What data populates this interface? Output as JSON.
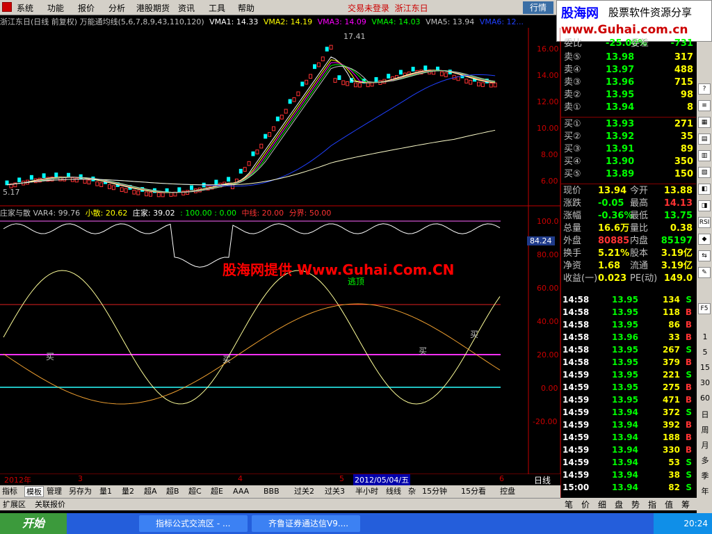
{
  "menu": {
    "items": [
      "系统",
      "功能",
      "报价",
      "分析",
      "港股期货",
      "资讯",
      "工具",
      "帮助"
    ],
    "status": "交易未登录",
    "stock_name": "浙江东日",
    "quote_button": "行情"
  },
  "ad": {
    "brand": "股海网",
    "tagline": "股票软件资源分享",
    "url": "www.Guhai.com.cn"
  },
  "chart_title": {
    "name": "浙江东日(日线 前复权) 万能通均线(5,6,7,8,9,43,110,120)",
    "vma1": "VMA1: 14.33",
    "vma2": "VMA2: 14.19",
    "vma3": "VMA3: 14.09",
    "vma4": "VMA4: 14.03",
    "vma5": "VMA5: 13.94",
    "vma6": "VMA6: 12..."
  },
  "price_axis": [
    "16.00",
    "14.00",
    "12.00",
    "10.00",
    "8.00",
    "6.00"
  ],
  "price_annotations": {
    "high": "17.41",
    "low": "5.17"
  },
  "indicator_title": {
    "name": "庄家与散 VAR4: 99.76",
    "xs": "小散: 20.62",
    "zj": "庄家: 39.02",
    "lines": ": 100.00 : 0.00",
    "mid": "中线: 20.00",
    "div": "分界: 50.00"
  },
  "indicator_axis": [
    "100.0",
    "80.00",
    "60.00",
    "40.00",
    "20.00",
    "0.00",
    "-20.00"
  ],
  "indicator_value_badge": "84.24",
  "indicator_labels": {
    "buy": "买",
    "top": "逃顶"
  },
  "watermark": "股海网提供 Www.Guhai.Com.CN",
  "order_book": {
    "header": {
      "label": "委比",
      "value": "-25.00%",
      "label2": "委差",
      "value2": "-731"
    },
    "asks": [
      {
        "label": "卖⑤",
        "price": "13.98",
        "vol": "317"
      },
      {
        "label": "卖④",
        "price": "13.97",
        "vol": "488"
      },
      {
        "label": "卖③",
        "price": "13.96",
        "vol": "715"
      },
      {
        "label": "卖②",
        "price": "13.95",
        "vol": "98"
      },
      {
        "label": "卖①",
        "price": "13.94",
        "vol": "8"
      }
    ],
    "bids": [
      {
        "label": "买①",
        "price": "13.93",
        "vol": "271"
      },
      {
        "label": "买②",
        "price": "13.92",
        "vol": "35"
      },
      {
        "label": "买③",
        "price": "13.91",
        "vol": "89"
      },
      {
        "label": "买④",
        "price": "13.90",
        "vol": "350"
      },
      {
        "label": "买⑤",
        "price": "13.89",
        "vol": "150"
      }
    ]
  },
  "stats": [
    {
      "l1": "现价",
      "v1": "13.94",
      "c1": "#ff0",
      "l2": "今开",
      "v2": "13.88",
      "c2": "#ff0"
    },
    {
      "l1": "涨跌",
      "v1": "-0.05",
      "c1": "#0f0",
      "l2": "最高",
      "v2": "14.13",
      "c2": "#f33"
    },
    {
      "l1": "涨幅",
      "v1": "-0.36%",
      "c1": "#0f0",
      "l2": "最低",
      "v2": "13.75",
      "c2": "#0f0"
    },
    {
      "l1": "总量",
      "v1": "16.6万",
      "c1": "#ff0",
      "l2": "量比",
      "v2": "0.38",
      "c2": "#ff0"
    },
    {
      "l1": "外盘",
      "v1": "80885",
      "c1": "#f33",
      "l2": "内盘",
      "v2": "85197",
      "c2": "#0f0"
    },
    {
      "l1": "换手",
      "v1": "5.21%",
      "c1": "#ff0",
      "l2": "股本",
      "v2": "3.19亿",
      "c2": "#ff0"
    },
    {
      "l1": "净资",
      "v1": "1.68",
      "c1": "#ff0",
      "l2": "流通",
      "v2": "3.19亿",
      "c2": "#ff0"
    },
    {
      "l1": "收益(一)",
      "v1": "0.023",
      "c1": "#ff0",
      "l2": "PE(动)",
      "v2": "149.0",
      "c2": "#ff0"
    }
  ],
  "ticks": [
    {
      "t": "14:58",
      "p": "13.95",
      "q": "134",
      "d": "S"
    },
    {
      "t": "14:58",
      "p": "13.95",
      "q": "118",
      "d": "B"
    },
    {
      "t": "14:58",
      "p": "13.95",
      "q": "86",
      "d": "B"
    },
    {
      "t": "14:58",
      "p": "13.96",
      "q": "33",
      "d": "B"
    },
    {
      "t": "14:58",
      "p": "13.95",
      "q": "267",
      "d": "S"
    },
    {
      "t": "14:58",
      "p": "13.95",
      "q": "379",
      "d": "B"
    },
    {
      "t": "14:59",
      "p": "13.95",
      "q": "221",
      "d": "S"
    },
    {
      "t": "14:59",
      "p": "13.95",
      "q": "275",
      "d": "B"
    },
    {
      "t": "14:59",
      "p": "13.95",
      "q": "471",
      "d": "B"
    },
    {
      "t": "14:59",
      "p": "13.94",
      "q": "372",
      "d": "S"
    },
    {
      "t": "14:59",
      "p": "13.94",
      "q": "392",
      "d": "B"
    },
    {
      "t": "14:59",
      "p": "13.94",
      "q": "188",
      "d": "B"
    },
    {
      "t": "14:59",
      "p": "13.94",
      "q": "330",
      "d": "B"
    },
    {
      "t": "14:59",
      "p": "13.94",
      "q": "53",
      "d": "S"
    },
    {
      "t": "14:59",
      "p": "13.94",
      "q": "38",
      "d": "S"
    },
    {
      "t": "15:00",
      "p": "13.94",
      "q": "82",
      "d": "S"
    }
  ],
  "date_axis": [
    "2012年",
    "3",
    "4",
    "5",
    "2012/05/04/五",
    "6"
  ],
  "period_label": "日线",
  "bottom_tabs": [
    "指标",
    "模板",
    "管理",
    "另存为",
    "量1",
    "量2",
    "超A",
    "超B",
    "超C",
    "超E",
    "AAA",
    "BBB",
    "过关2",
    "过关3",
    "半小时",
    "线线",
    "杂",
    "15分钟",
    "15分看",
    "控盘"
  ],
  "bottom_tabs2": [
    "扩展区",
    "关联报价"
  ],
  "right_tabs": [
    "笔",
    "价",
    "细",
    "盘",
    "势",
    "指",
    "值",
    "筹"
  ],
  "sidebar_labels": [
    "1",
    "5",
    "15",
    "30",
    "60",
    "日",
    "周",
    "月",
    "多",
    "季",
    "年"
  ],
  "taskbar": {
    "start": "开始",
    "items": [
      "指标公式交流区 - ...",
      "齐鲁证券通达信V9...."
    ],
    "clock": "20:24"
  },
  "colors": {
    "up": "#ff3333",
    "down": "#00ffff",
    "axis": "#c00000",
    "ma_blue": "#2040ff",
    "ma_white": "#ffffcc"
  }
}
